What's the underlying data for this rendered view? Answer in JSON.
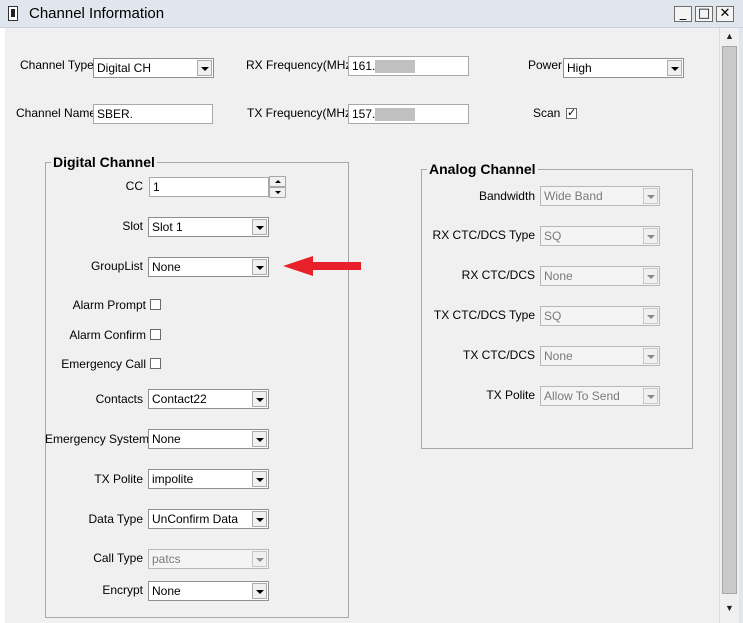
{
  "window": {
    "title": "Channel Information",
    "minimize": "_",
    "maximize": "□",
    "close": "✕"
  },
  "top": {
    "channel_type": {
      "label": "Channel Type",
      "value": "Digital CH"
    },
    "channel_name": {
      "label": "Channel Name",
      "value": "SBER."
    },
    "rx_freq": {
      "label": "RX Frequency(MHz)",
      "value": "161."
    },
    "tx_freq": {
      "label": "TX Frequency(MHz)",
      "value": "157."
    },
    "power": {
      "label": "Power",
      "value": "High"
    },
    "scan": {
      "label": "Scan",
      "checked": true,
      "mark": "✓"
    }
  },
  "digital": {
    "title": "Digital Channel",
    "cc": {
      "label": "CC",
      "value": "1"
    },
    "slot": {
      "label": "Slot",
      "value": "Slot 1"
    },
    "grouplist": {
      "label": "GroupList",
      "value": "None"
    },
    "alarm_prompt": {
      "label": "Alarm Prompt",
      "checked": false
    },
    "alarm_confirm": {
      "label": "Alarm Confirm",
      "checked": false
    },
    "emergency_call": {
      "label": "Emergency Call",
      "checked": false
    },
    "contacts": {
      "label": "Contacts",
      "value": "Contact22"
    },
    "emergency_system": {
      "label": "Emergency System",
      "value": "None"
    },
    "tx_polite": {
      "label": "TX Polite",
      "value": "impolite"
    },
    "data_type": {
      "label": "Data Type",
      "value": "UnConfirm Data"
    },
    "call_type": {
      "label": "Call Type",
      "value": "patcs"
    },
    "encrypt": {
      "label": "Encrypt",
      "value": "None"
    }
  },
  "analog": {
    "title": "Analog Channel",
    "bandwidth": {
      "label": "Bandwidth",
      "value": "Wide Band"
    },
    "rx_ctc_type": {
      "label": "RX CTC/DCS Type",
      "value": "SQ"
    },
    "rx_ctc": {
      "label": "RX CTC/DCS",
      "value": "None"
    },
    "tx_ctc_type": {
      "label": "TX CTC/DCS Type",
      "value": "SQ"
    },
    "tx_ctc": {
      "label": "TX CTC/DCS",
      "value": "None"
    },
    "tx_polite": {
      "label": "TX Polite",
      "value": "Allow To Send"
    }
  },
  "colors": {
    "annotation_arrow": "#e8202a",
    "title_bar": "#dfe6ee",
    "client_bg": "#f0f0f0"
  },
  "icons": {
    "app": "radio-icon",
    "pointer": "red-arrow-icon"
  }
}
